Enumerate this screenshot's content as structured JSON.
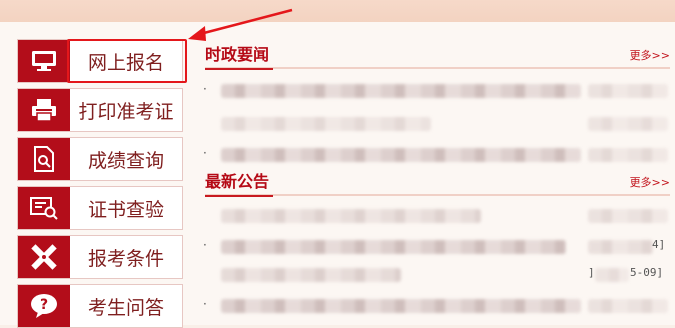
{
  "sidebar": {
    "items": [
      {
        "label": "网上报名",
        "icon": "monitor-icon"
      },
      {
        "label": "打印准考证",
        "icon": "printer-icon"
      },
      {
        "label": "成绩查询",
        "icon": "document-search-icon"
      },
      {
        "label": "证书查验",
        "icon": "certificate-search-icon"
      },
      {
        "label": "报考条件",
        "icon": "pencil-ruler-icon"
      },
      {
        "label": "考生问答",
        "icon": "question-bubble-icon"
      }
    ]
  },
  "annotation": {
    "highlight_color": "#e4171b"
  },
  "sections": [
    {
      "title": "时政要闻",
      "more": "更多>>"
    },
    {
      "title": "最新公告",
      "more": "更多>>"
    }
  ],
  "date_fragments": [
    "4]",
    "]",
    "5-09]"
  ],
  "colors": {
    "brand_red": "#b30d1a",
    "background": "#fcf7f3"
  }
}
